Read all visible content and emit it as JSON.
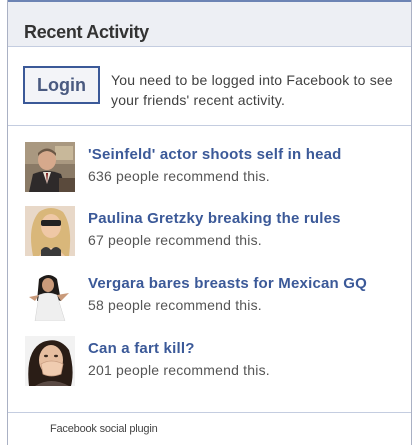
{
  "header": {
    "title": "Recent Activity"
  },
  "login": {
    "button_label": "Login",
    "message": "You need to be logged into Facebook to see your friends' recent activity."
  },
  "recommendations": [
    {
      "title": "'Seinfeld' actor shoots self in head",
      "count_text": "636 people recommend this.",
      "thumbnail_icon": "man-in-suit-photo"
    },
    {
      "title": "Paulina Gretzky breaking the rules",
      "count_text": "67 people recommend this.",
      "thumbnail_icon": "blonde-woman-photo"
    },
    {
      "title": "Vergara bares breasts for Mexican GQ",
      "count_text": "58 people recommend this.",
      "thumbnail_icon": "woman-white-dress-photo"
    },
    {
      "title": "Can a fart kill?",
      "count_text": "201 people recommend this.",
      "thumbnail_icon": "woman-covering-nose-photo"
    }
  ],
  "footer": {
    "text": "Facebook social plugin"
  },
  "colors": {
    "link_blue": "#3b5998",
    "header_bg": "#edeff4",
    "border": "#c4cde0"
  }
}
